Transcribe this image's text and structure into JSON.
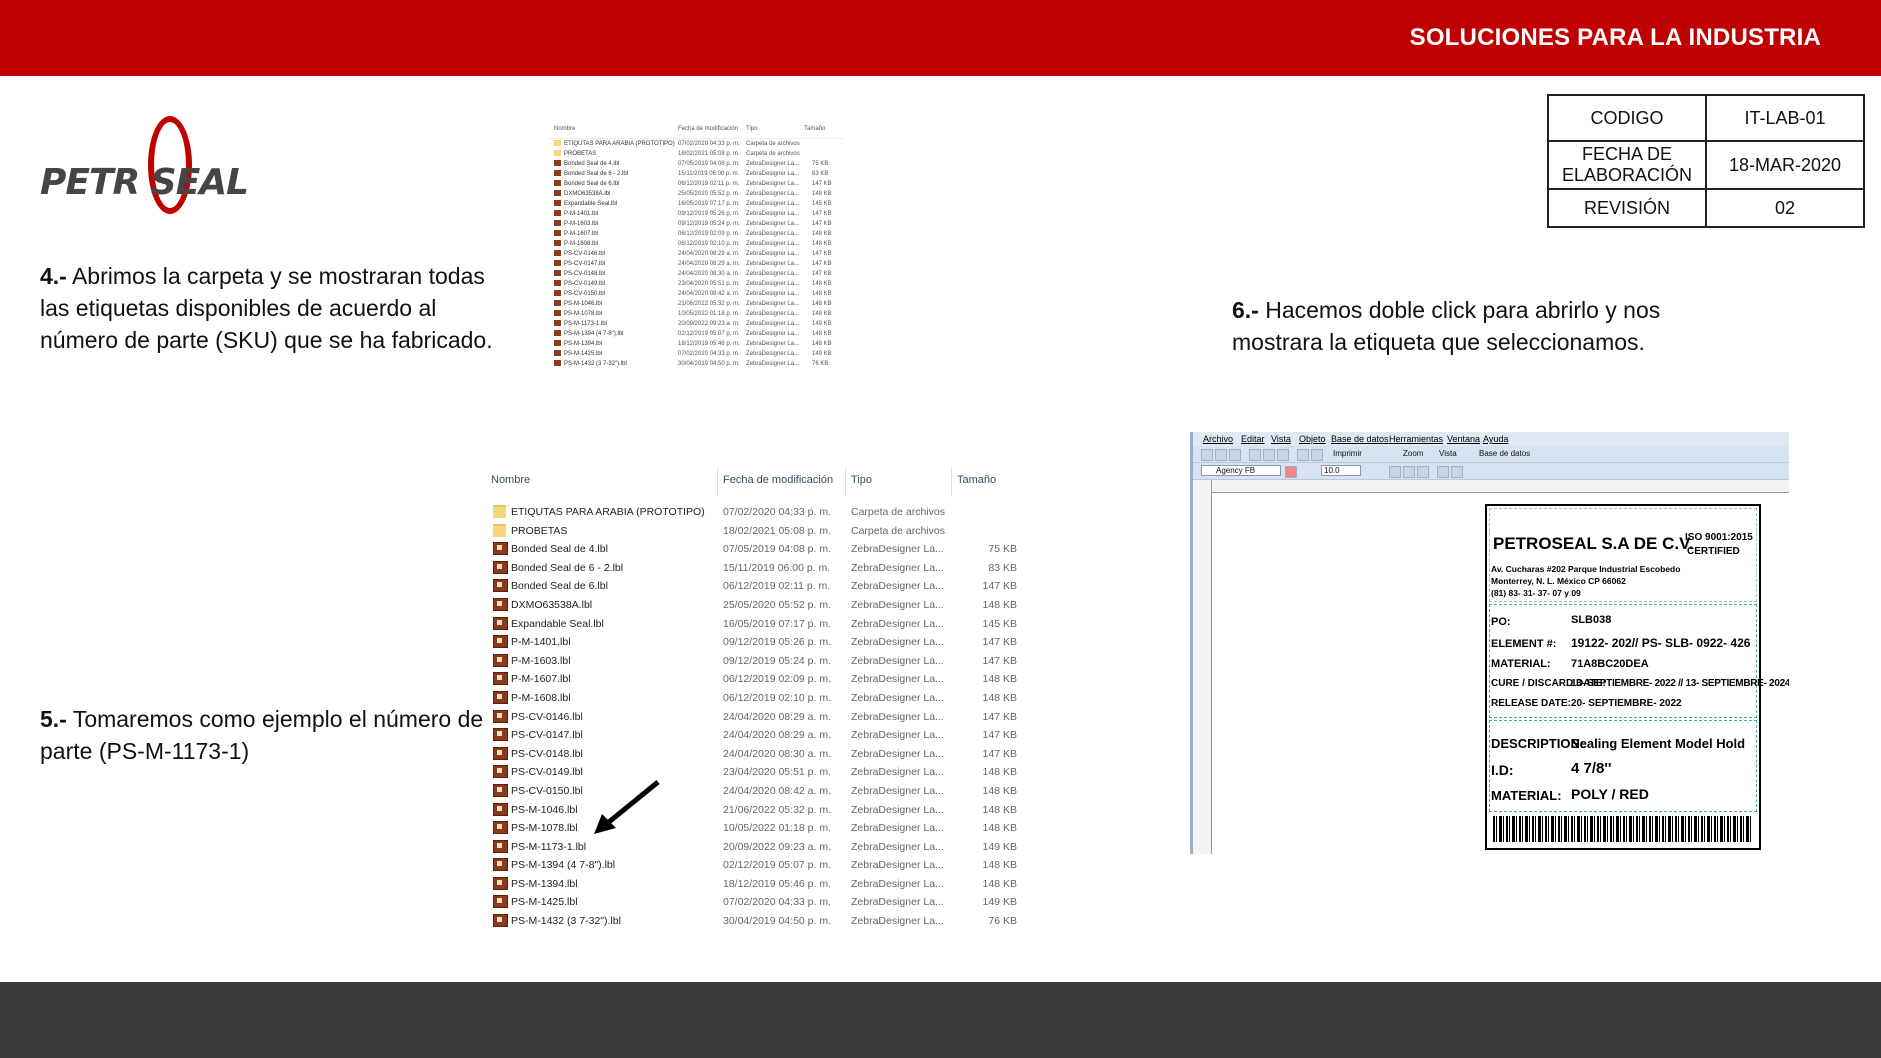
{
  "header": {
    "title": "SOLUCIONES PARA LA INDUSTRIA"
  },
  "logo": {
    "text": "PETR SEAL"
  },
  "info_table": [
    {
      "label": "CODIGO",
      "value": "IT-LAB-01"
    },
    {
      "label": "FECHA DE ELABORACIÓN",
      "value": "18-MAR-2020"
    },
    {
      "label": "REVISIÓN",
      "value": "02"
    }
  ],
  "steps": {
    "s4": {
      "num": "4.-",
      "text": " Abrimos la carpeta y se mostraran todas las etiquetas disponibles de acuerdo al número de parte (SKU) que se ha fabricado."
    },
    "s5": {
      "num": "5.-",
      "text": " Tomaremos como ejemplo el número de parte (PS-M-1173-1)"
    },
    "s6": {
      "num": "6.-",
      "text": " Hacemos doble click para abrirlo y nos mostrara la etiqueta que seleccionamos."
    }
  },
  "explorer": {
    "columns": [
      "Nombre",
      "Fecha de modificación",
      "Tipo",
      "Tamaño"
    ],
    "rows": [
      {
        "name": "ETIQUTAS PARA ARABIA (PROTOTIPO)",
        "date": "07/02/2020 04:33 p. m.",
        "type": "Carpeta de archivos",
        "size": "",
        "icon": "folder"
      },
      {
        "name": "PROBETAS",
        "date": "18/02/2021 05:08 p. m.",
        "type": "Carpeta de archivos",
        "size": "",
        "icon": "folder"
      },
      {
        "name": "Bonded Seal de 4.lbl",
        "date": "07/05/2019 04:08 p. m.",
        "type": "ZebraDesigner La...",
        "size": "75 KB",
        "icon": "file"
      },
      {
        "name": "Bonded Seal de 6 - 2.lbl",
        "date": "15/11/2019 06:00 p. m.",
        "type": "ZebraDesigner La...",
        "size": "83 KB",
        "icon": "file"
      },
      {
        "name": "Bonded Seal de 6.lbl",
        "date": "06/12/2019 02:11 p. m.",
        "type": "ZebraDesigner La...",
        "size": "147 KB",
        "icon": "file"
      },
      {
        "name": "DXMO63538A.lbl",
        "date": "25/05/2020 05:52 p. m.",
        "type": "ZebraDesigner La...",
        "size": "148 KB",
        "icon": "file"
      },
      {
        "name": "Expandable Seal.lbl",
        "date": "16/05/2019 07:17 p. m.",
        "type": "ZebraDesigner La...",
        "size": "145 KB",
        "icon": "file"
      },
      {
        "name": "P-M-1401.lbl",
        "date": "09/12/2019 05:26 p. m.",
        "type": "ZebraDesigner La...",
        "size": "147 KB",
        "icon": "file"
      },
      {
        "name": "P-M-1603.lbl",
        "date": "09/12/2019 05:24 p. m.",
        "type": "ZebraDesigner La...",
        "size": "147 KB",
        "icon": "file"
      },
      {
        "name": "P-M-1607.lbl",
        "date": "06/12/2019 02:09 p. m.",
        "type": "ZebraDesigner La...",
        "size": "148 KB",
        "icon": "file"
      },
      {
        "name": "P-M-1608.lbl",
        "date": "06/12/2019 02:10 p. m.",
        "type": "ZebraDesigner La...",
        "size": "148 KB",
        "icon": "file"
      },
      {
        "name": "PS-CV-0146.lbl",
        "date": "24/04/2020 08:29 a. m.",
        "type": "ZebraDesigner La...",
        "size": "147 KB",
        "icon": "file"
      },
      {
        "name": "PS-CV-0147.lbl",
        "date": "24/04/2020 08:29 a. m.",
        "type": "ZebraDesigner La...",
        "size": "147 KB",
        "icon": "file"
      },
      {
        "name": "PS-CV-0148.lbl",
        "date": "24/04/2020 08:30 a. m.",
        "type": "ZebraDesigner La...",
        "size": "147 KB",
        "icon": "file"
      },
      {
        "name": "PS-CV-0149.lbl",
        "date": "23/04/2020 05:51 p. m.",
        "type": "ZebraDesigner La...",
        "size": "148 KB",
        "icon": "file"
      },
      {
        "name": "PS-CV-0150.lbl",
        "date": "24/04/2020 08:42 a. m.",
        "type": "ZebraDesigner La...",
        "size": "148 KB",
        "icon": "file"
      },
      {
        "name": "PS-M-1046.lbl",
        "date": "21/06/2022 05:32 p. m.",
        "type": "ZebraDesigner La...",
        "size": "148 KB",
        "icon": "file"
      },
      {
        "name": "PS-M-1078.lbl",
        "date": "10/05/2022 01:18 p. m.",
        "type": "ZebraDesigner La...",
        "size": "148 KB",
        "icon": "file"
      },
      {
        "name": "PS-M-1173-1.lbl",
        "date": "20/09/2022 09:23 a. m.",
        "type": "ZebraDesigner La...",
        "size": "149 KB",
        "icon": "file"
      },
      {
        "name": "PS-M-1394 (4 7-8\").lbl",
        "date": "02/12/2019 05:07 p. m.",
        "type": "ZebraDesigner La...",
        "size": "148 KB",
        "icon": "file"
      },
      {
        "name": "PS-M-1394.lbl",
        "date": "18/12/2019 05:46 p. m.",
        "type": "ZebraDesigner La...",
        "size": "148 KB",
        "icon": "file"
      },
      {
        "name": "PS-M-1425.lbl",
        "date": "07/02/2020 04:33 p. m.",
        "type": "ZebraDesigner La...",
        "size": "149 KB",
        "icon": "file"
      },
      {
        "name": "PS-M-1432 (3 7-32\").lbl",
        "date": "30/04/2019 04:50 p. m.",
        "type": "ZebraDesigner La...",
        "size": "76 KB",
        "icon": "file"
      }
    ]
  },
  "designer": {
    "menu": [
      "Archivo",
      "Editar",
      "Vista",
      "Objeto",
      "Base de datos",
      "Herramientas",
      "Ventana",
      "Ayuda"
    ],
    "toolbar": {
      "print": "Imprimir",
      "zoom": "Zoom",
      "view": "Vista",
      "database": "Base de datos",
      "font": "Agency FB",
      "font_size": "10.0"
    },
    "label": {
      "company": "PETROSEAL S.A DE C.V.",
      "iso": "ISO 9001:2015",
      "certified": "CERTIFIED",
      "address1": "Av. Cucharas #202 Parque Industrial Escobedo",
      "address2": "Monterrey, N. L. México CP 66062",
      "phone": "(81) 83- 31- 37- 07 y 09",
      "po_label": "PO:",
      "po_value": "SLB038",
      "element_label": "ELEMENT #:",
      "element_value": "19122- 202// PS- SLB- 0922- 426",
      "material_label": "MATERIAL:",
      "material_value": "71A8BC20DEA",
      "cure_label": "CURE / DISCARD DATE:",
      "cure_value": "13- SEPTIEMBRE- 2022 // 13- SEPTIEMBRE- 2024",
      "release_label": "RELEASE DATE:",
      "release_value": "20- SEPTIEMBRE- 2022",
      "desc_label": "DESCRIPTION:",
      "desc_value": "Sealing Element Model Hold",
      "id_label": "I.D:",
      "id_value": "4 7/8''",
      "mat2_label": "MATERIAL:",
      "mat2_value": "POLY / RED"
    }
  },
  "colors": {
    "brand_red": "#c00000",
    "footer": "#3b3b3b"
  }
}
